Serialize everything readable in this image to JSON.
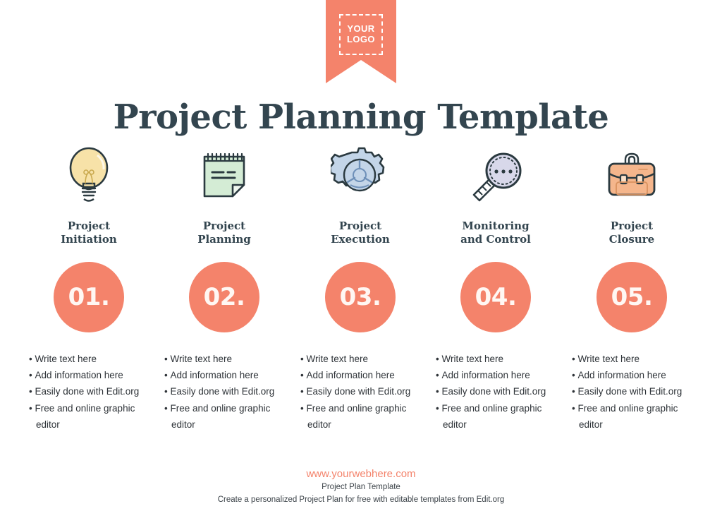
{
  "logo": {
    "line1": "YOUR",
    "line2": "LOGO"
  },
  "title": "Project Planning Template",
  "colors": {
    "accent": "#F4836B",
    "title": "#33454F",
    "body_text": "#2E3338",
    "bulb_fill": "#F7E2A8",
    "notepad_fill": "#D4ECD5",
    "gear_fill": "#C3D5E8",
    "lens_fill": "#D8D8EA",
    "briefcase_fill": "#F5B68C",
    "outline": "#2B3A40"
  },
  "columns": [
    {
      "icon": "lightbulb-icon",
      "label_line1": "Project",
      "label_line2": "Initiation",
      "number": "01.",
      "bullets": [
        "Write text here",
        "Add information here",
        "Easily done with Edit.org",
        "Free and online graphic editor"
      ]
    },
    {
      "icon": "notepad-icon",
      "label_line1": "Project",
      "label_line2": "Planning",
      "number": "02.",
      "bullets": [
        "Write text here",
        "Add information here",
        "Easily done with Edit.org",
        "Free and online graphic editor"
      ]
    },
    {
      "icon": "gear-icon",
      "label_line1": "Project",
      "label_line2": "Execution",
      "number": "03.",
      "bullets": [
        "Write text here",
        "Add information here",
        "Easily done with Edit.org",
        "Free and online graphic editor"
      ]
    },
    {
      "icon": "magnifier-icon",
      "label_line1": "Monitoring",
      "label_line2": "and Control",
      "number": "04.",
      "bullets": [
        "Write text here",
        "Add information here",
        "Easily done with Edit.org",
        "Free and online graphic editor"
      ]
    },
    {
      "icon": "briefcase-icon",
      "label_line1": "Project",
      "label_line2": "Closure",
      "number": "05.",
      "bullets": [
        "Write text here",
        "Add information here",
        "Easily done with Edit.org",
        "Free and online graphic editor"
      ]
    }
  ],
  "footer": {
    "url": "www.yourwebhere.com",
    "line1": "Project Plan Template",
    "line2": "Create a personalized Project Plan for free with editable templates from Edit.org"
  }
}
